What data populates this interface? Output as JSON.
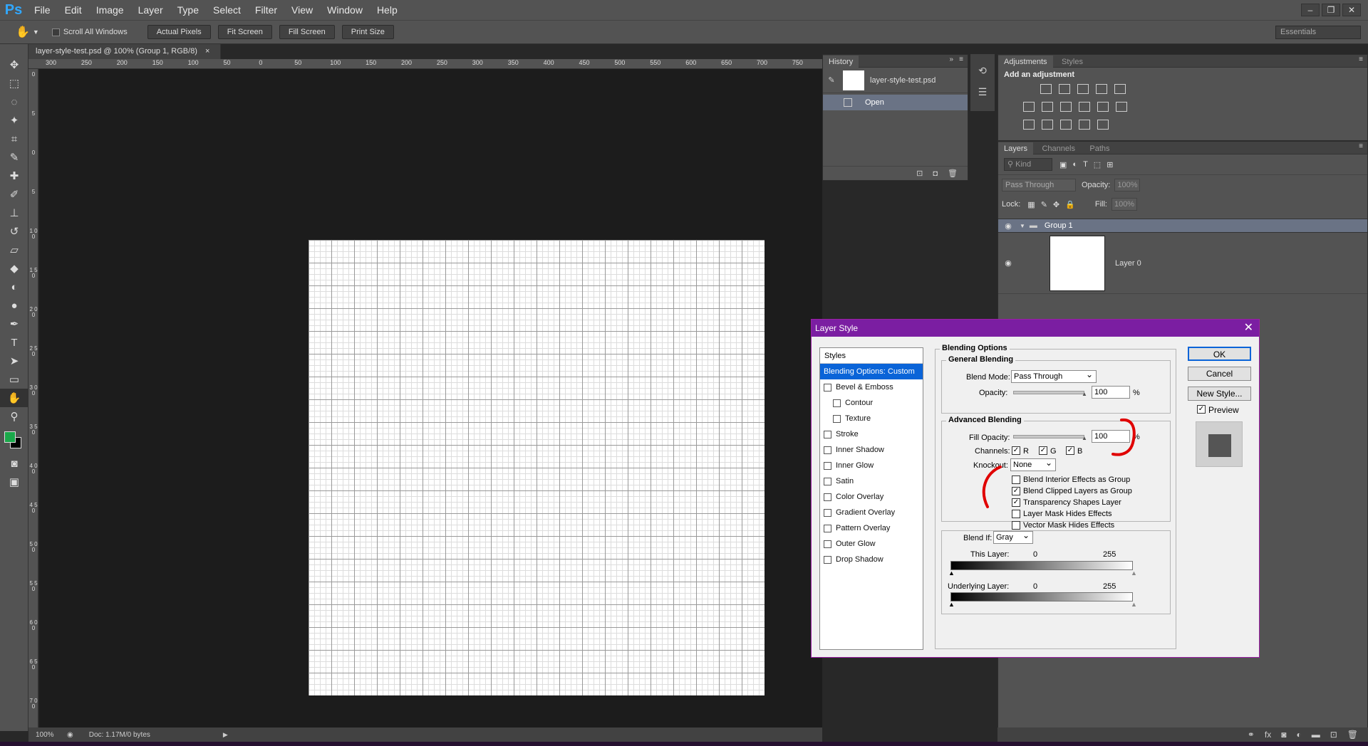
{
  "app": {
    "logo": "Ps"
  },
  "menu": [
    "File",
    "Edit",
    "Image",
    "Layer",
    "Type",
    "Select",
    "Filter",
    "View",
    "Window",
    "Help"
  ],
  "options": {
    "scroll_all": "Scroll All Windows",
    "actual_pixels": "Actual Pixels",
    "fit_screen": "Fit Screen",
    "fill_screen": "Fill Screen",
    "print_size": "Print Size",
    "workspace": "Essentials"
  },
  "document": {
    "tab": "layer-style-test.psd @ 100% (Group 1, RGB/8)",
    "zoom": "100%",
    "doc_info": "Doc: 1.17M/0 bytes"
  },
  "ruler": {
    "h": [
      "300",
      "250",
      "200",
      "150",
      "100",
      "50",
      "0",
      "50",
      "100",
      "150",
      "200",
      "250",
      "300",
      "350",
      "400",
      "450",
      "500",
      "550",
      "600",
      "650",
      "700",
      "750"
    ],
    "v": [
      "0",
      "5",
      "0",
      "5",
      "1 0 0",
      "1 5 0",
      "2 0 0",
      "2 5 0",
      "3 0 0",
      "3 5 0",
      "4 0 0",
      "4 5 0",
      "5 0 0",
      "5 5 0",
      "6 0 0",
      "6 5 0",
      "7 0 0"
    ]
  },
  "history": {
    "tab": "History",
    "snapshot": "layer-style-test.psd",
    "state": "Open"
  },
  "adjustments": {
    "tabs": [
      "Adjustments",
      "Styles"
    ],
    "heading": "Add an adjustment"
  },
  "layers": {
    "tabs": [
      "Layers",
      "Channels",
      "Paths"
    ],
    "kind": "Kind",
    "blend": "Pass Through",
    "opacity_label": "Opacity:",
    "opacity": "100%",
    "lock_label": "Lock:",
    "fill_label": "Fill:",
    "fill": "100%",
    "group": "Group 1",
    "layer": "Layer 0"
  },
  "dialog": {
    "title": "Layer Style",
    "styles_header": "Styles",
    "styles": [
      {
        "label": "Blending Options: Custom",
        "checkbox": false,
        "selected": true,
        "indent": false
      },
      {
        "label": "Bevel & Emboss",
        "checkbox": true,
        "indent": false
      },
      {
        "label": "Contour",
        "checkbox": true,
        "indent": true
      },
      {
        "label": "Texture",
        "checkbox": true,
        "indent": true
      },
      {
        "label": "Stroke",
        "checkbox": true,
        "indent": false
      },
      {
        "label": "Inner Shadow",
        "checkbox": true,
        "indent": false
      },
      {
        "label": "Inner Glow",
        "checkbox": true,
        "indent": false
      },
      {
        "label": "Satin",
        "checkbox": true,
        "indent": false
      },
      {
        "label": "Color Overlay",
        "checkbox": true,
        "indent": false
      },
      {
        "label": "Gradient Overlay",
        "checkbox": true,
        "indent": false
      },
      {
        "label": "Pattern Overlay",
        "checkbox": true,
        "indent": false
      },
      {
        "label": "Outer Glow",
        "checkbox": true,
        "indent": false
      },
      {
        "label": "Drop Shadow",
        "checkbox": true,
        "indent": false
      }
    ],
    "blending_options": "Blending Options",
    "general_blending": "General Blending",
    "blend_mode_label": "Blend Mode:",
    "blend_mode": "Pass Through",
    "opacity_label": "Opacity:",
    "opacity": "100",
    "percent": "%",
    "advanced_blending": "Advanced Blending",
    "fill_opacity_label": "Fill Opacity:",
    "fill_opacity": "100",
    "channels_label": "Channels:",
    "channel_r": "R",
    "channel_g": "G",
    "channel_b": "B",
    "knockout_label": "Knockout:",
    "knockout": "None",
    "options": [
      {
        "label": "Blend Interior Effects as Group",
        "checked": false
      },
      {
        "label": "Blend Clipped Layers as Group",
        "checked": true
      },
      {
        "label": "Transparency Shapes Layer",
        "checked": true
      },
      {
        "label": "Layer Mask Hides Effects",
        "checked": false
      },
      {
        "label": "Vector Mask Hides Effects",
        "checked": false
      }
    ],
    "blend_if_label": "Blend If:",
    "blend_if": "Gray",
    "this_layer": "This Layer:",
    "underlying_layer": "Underlying Layer:",
    "range_min": "0",
    "range_max": "255",
    "ok": "OK",
    "cancel": "Cancel",
    "new_style": "New Style...",
    "preview": "Preview"
  },
  "colors": {
    "accent": "#7b1ea2",
    "selection": "#0a64d8",
    "annotation": "#e00000",
    "foreground": "#1aa84a"
  }
}
